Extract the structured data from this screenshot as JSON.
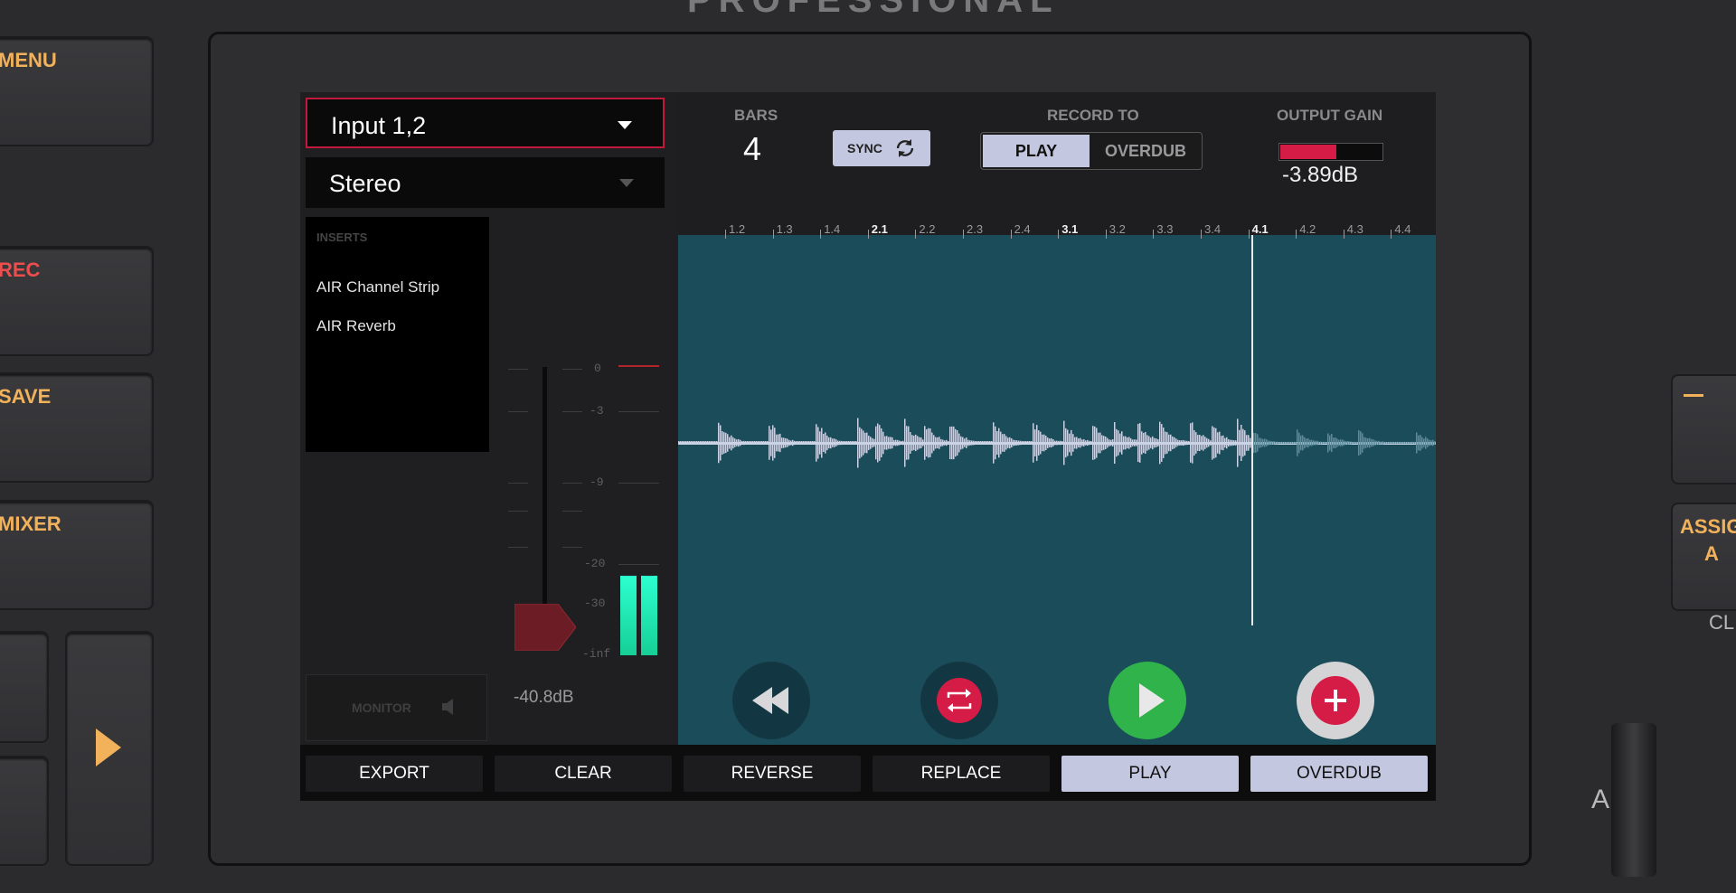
{
  "hardware": {
    "brand": "PROFESSIONAL",
    "buttons": {
      "menu": "MENU",
      "rec": "REC",
      "save": "SAVE",
      "mixer": "MIXER",
      "assign_a": "ASSIGN A",
      "clip": "CL",
      "fader_label": "A"
    }
  },
  "input": {
    "source": "Input 1,2",
    "mode": "Stereo"
  },
  "inserts": {
    "title": "INSERTS",
    "items": [
      "AIR Channel Strip",
      "AIR Reverb"
    ]
  },
  "fader": {
    "scale": [
      "0",
      "-3",
      "-9",
      "-20",
      "-30",
      "-inf"
    ],
    "gain_readout": "-40.8dB",
    "level_fraction": 0.17
  },
  "monitor": {
    "label": "MONITOR"
  },
  "bars": {
    "label": "BARS",
    "value": "4"
  },
  "sync": {
    "label": "SYNC"
  },
  "record_to": {
    "label": "RECORD TO",
    "options": [
      "PLAY",
      "OVERDUB"
    ],
    "selected": "PLAY"
  },
  "output_gain": {
    "label": "OUTPUT GAIN",
    "value": "-3.89dB",
    "level_fraction": 0.55,
    "color": "#d51c46"
  },
  "ruler": {
    "labels": [
      "1.2",
      "1.3",
      "1.4",
      "2.1",
      "2.2",
      "2.3",
      "2.4",
      "3.1",
      "3.2",
      "3.3",
      "3.4",
      "4.1",
      "4.2",
      "4.3",
      "4.4"
    ],
    "major": [
      "2.1",
      "3.1",
      "4.1"
    ]
  },
  "transport": {
    "rewind": "rewind-icon",
    "loop": "loop-icon",
    "play": "play-icon",
    "add": "add-icon",
    "colors": {
      "loop": "#d51c46",
      "play": "#2fb34a",
      "add": "#d51c46"
    }
  },
  "bottom_buttons": {
    "export": "EXPORT",
    "clear": "CLEAR",
    "reverse": "REVERSE",
    "replace": "REPLACE",
    "play": "PLAY",
    "overdub": "OVERDUB"
  }
}
